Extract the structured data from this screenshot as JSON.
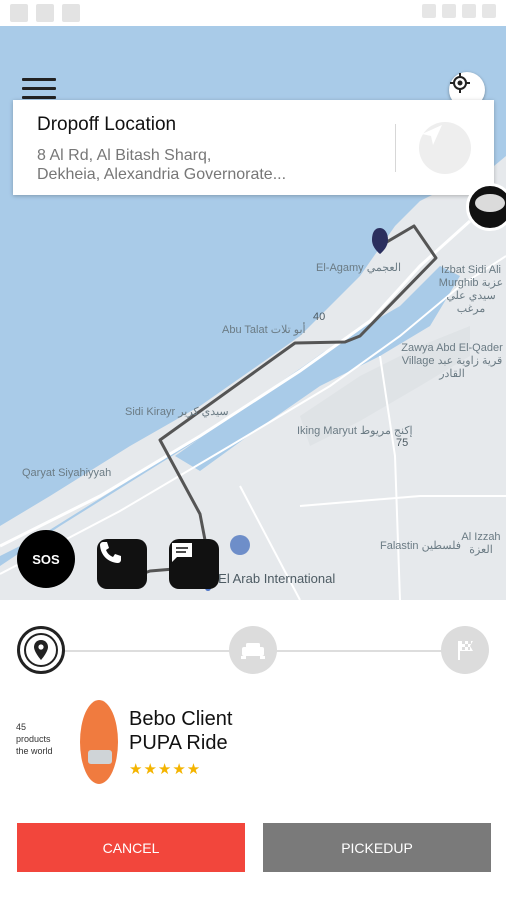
{
  "dropoff": {
    "title": "Dropoff Location",
    "address": "8 Al          Rd, Al Bitash Sharq,\nDekheia, Alexandria Governorate..."
  },
  "map_labels": {
    "el_agamy": "El-Agamy\nالعجمي",
    "izbat_sidi": "Izbat Sidi\nAli Murghib\nعزبة سيدي\nعلي مرغب",
    "abu_talat": "Abu Talat\nأبو تلات",
    "road_40": "40",
    "zawya": "Zawya Abd\nEl-Qader\nVillage\nقرية زاوية\nعبد القادر",
    "sidi_kirayr": "Sidi Kirayr\nسيدي كرير",
    "iking_maryut": "Iking Maryut\nإكنج مريوط",
    "road_75": "75",
    "qaryat": "Qaryat\nSiyahiyyah",
    "falastin": "Falastin\nفلسطين",
    "al_izzah": "Al Izzah\nالعزة",
    "borg_el_arab": "rg El Arab\nInternational"
  },
  "sos_label": "SOS",
  "promo_text": "45\nproducts\nthe world",
  "driver": {
    "name": "Bebo Client",
    "service": "PUPA Ride",
    "rating": 5,
    "rating_stars": "★★★★★"
  },
  "actions": {
    "cancel_label": "CANCEL",
    "pickup_label": "PICKEDUP"
  },
  "colors": {
    "cancel": "#f2463c",
    "pickup": "#7a7a7a",
    "route": "#555555",
    "water": "#a9cbe8",
    "land": "#e5e8eb",
    "star": "#f4b400"
  },
  "icons": {
    "menu": "menu-icon",
    "locate": "crosshair-icon",
    "navigate": "navigation-arrow-icon",
    "call": "phone-icon",
    "chat": "chat-icon",
    "step_pickup": "location-pin-icon",
    "step_ride": "car-icon",
    "step_finish": "checkered-flag-icon"
  }
}
